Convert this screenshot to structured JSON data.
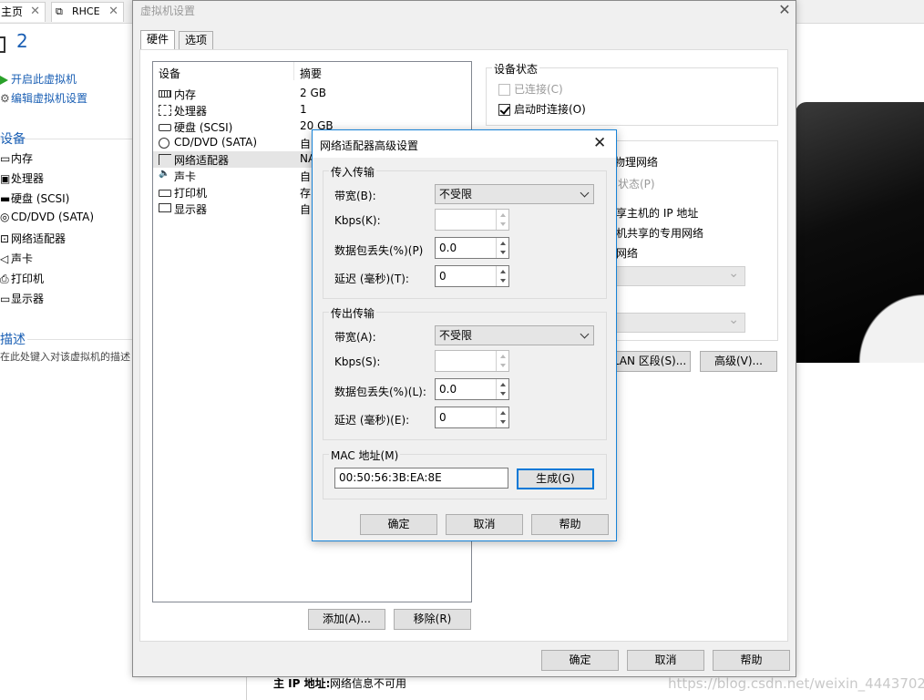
{
  "background": {
    "tabs": [
      {
        "label": "主页"
      },
      {
        "label": "RHCE"
      }
    ],
    "vm_title": "2",
    "actions": [
      "开启此虚拟机",
      "编辑虚拟机设置"
    ],
    "devices_heading": "设备",
    "devices": [
      "内存",
      "处理器",
      "硬盘 (SCSI)",
      "CD/DVD (SATA)",
      "网络适配器",
      "声卡",
      "打印机",
      "显示器"
    ],
    "description_heading": "描述",
    "description_placeholder": "在此处键入对该虚拟机的描述",
    "ip_label": "主 IP 地址:",
    "ip_value": "网络信息不可用",
    "watermark": "https://blog.csdn.net/weixin_44437026"
  },
  "vm_settings": {
    "title": "虚拟机设置",
    "tabs": [
      "硬件",
      "选项"
    ],
    "active_tab": "硬件",
    "list_headers": {
      "device": "设备",
      "summary": "摘要"
    },
    "devices": [
      {
        "name": "内存",
        "summary": "2 GB",
        "icon": "memory-icon"
      },
      {
        "name": "处理器",
        "summary": "1",
        "icon": "cpu-icon"
      },
      {
        "name": "硬盘 (SCSI)",
        "summary": "20 GB",
        "icon": "hdd-icon"
      },
      {
        "name": "CD/DVD (SATA)",
        "summary": "自",
        "icon": "cd-icon"
      },
      {
        "name": "网络适配器",
        "summary": "NA",
        "icon": "network-icon",
        "selected": true
      },
      {
        "name": "声卡",
        "summary": "自",
        "icon": "sound-icon"
      },
      {
        "name": "打印机",
        "summary": "存",
        "icon": "printer-icon"
      },
      {
        "name": "显示器",
        "summary": "自",
        "icon": "display-icon"
      }
    ],
    "add_button": "添加(A)...",
    "remove_button": "移除(R)",
    "device_status": {
      "label": "设备状态",
      "connected": "已连接(C)",
      "connect_at_power_on": "启动时连接(O)",
      "connected_checked": false,
      "connected_enabled": false,
      "connect_at_power_on_checked": true
    },
    "network_connection_fragments": {
      "bridged": "接物理网络",
      "replicate": "状态(P)",
      "nat": "享主机的 IP 地址",
      "host_only": "机共享的专用网络",
      "custom": "网络"
    },
    "lan_segments_button": "LAN 区段(S)...",
    "advanced_button": "高级(V)...",
    "ok_button": "确定",
    "cancel_button": "取消",
    "help_button": "帮助"
  },
  "advanced": {
    "title": "网络适配器高级设置",
    "incoming": {
      "label": "传入传输",
      "bandwidth_label": "带宽(B):",
      "bandwidth_value": "不受限",
      "kbps_label": "Kbps(K):",
      "kbps_value": "",
      "loss_label": "数据包丢失(%)(P)",
      "loss_value": "0.0",
      "latency_label": "延迟 (毫秒)(T):",
      "latency_value": "0"
    },
    "outgoing": {
      "label": "传出传输",
      "bandwidth_label": "带宽(A):",
      "bandwidth_value": "不受限",
      "kbps_label": "Kbps(S):",
      "kbps_value": "",
      "loss_label": "数据包丢失(%)(L):",
      "loss_value": "0.0",
      "latency_label": "延迟 (毫秒)(E):",
      "latency_value": "0"
    },
    "mac": {
      "label": "MAC 地址(M)",
      "value": "00:50:56:3B:EA:8E",
      "generate_button": "生成(G)"
    },
    "ok_button": "确定",
    "cancel_button": "取消",
    "help_button": "帮助"
  },
  "colors": {
    "link_blue": "#1a5fb4",
    "focus_blue": "#0078d7",
    "dialog_bg": "#f0f0f0"
  }
}
